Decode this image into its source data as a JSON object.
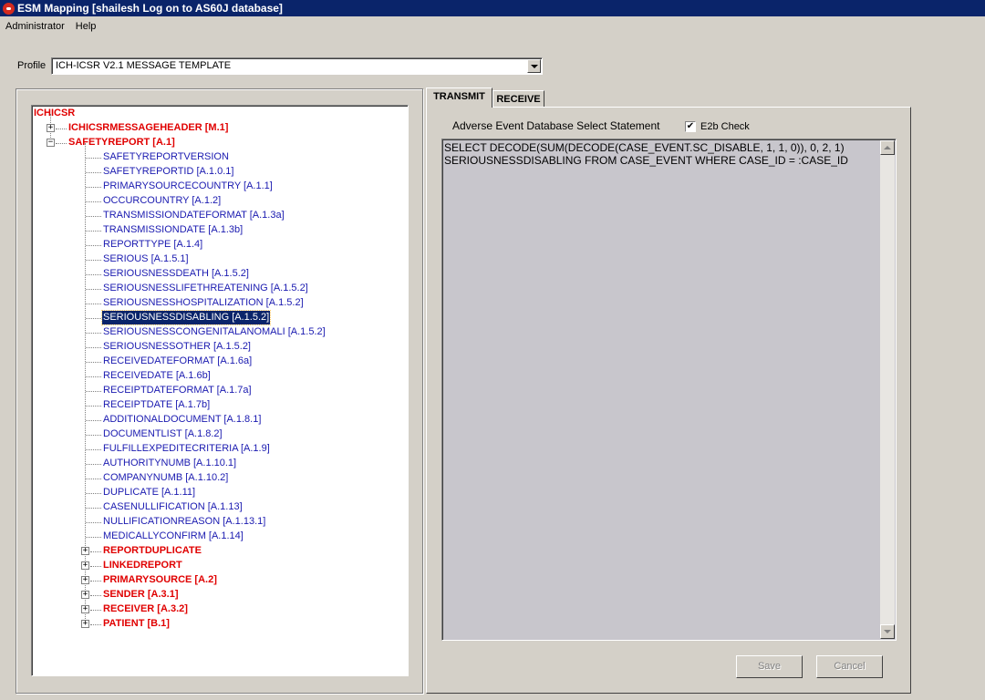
{
  "window": {
    "title": "ESM Mapping [shailesh Log on to AS60J database]"
  },
  "menu": [
    {
      "label": "Administrator"
    },
    {
      "label": "Help"
    }
  ],
  "profile": {
    "label": "Profile",
    "value": "ICH-ICSR V2.1 MESSAGE TEMPLATE"
  },
  "tree": {
    "root": "ICHICSR",
    "header_node": "ICHICSRMESSAGEHEADER [M.1]",
    "safety_node": "SAFETYREPORT [A.1]",
    "children": [
      "SAFETYREPORTVERSION",
      "SAFETYREPORTID [A.1.0.1]",
      "PRIMARYSOURCECOUNTRY [A.1.1]",
      "OCCURCOUNTRY [A.1.2]",
      "TRANSMISSIONDATEFORMAT [A.1.3a]",
      "TRANSMISSIONDATE [A.1.3b]",
      "REPORTTYPE [A.1.4]",
      "SERIOUS [A.1.5.1]",
      "SERIOUSNESSDEATH [A.1.5.2]",
      "SERIOUSNESSLIFETHREATENING [A.1.5.2]",
      "SERIOUSNESSHOSPITALIZATION [A.1.5.2]",
      "SERIOUSNESSDISABLING [A.1.5.2]",
      "SERIOUSNESSCONGENITALANOMALI [A.1.5.2]",
      "SERIOUSNESSOTHER [A.1.5.2]",
      "RECEIVEDATEFORMAT [A.1.6a]",
      "RECEIVEDATE [A.1.6b]",
      "RECEIPTDATEFORMAT [A.1.7a]",
      "RECEIPTDATE [A.1.7b]",
      "ADDITIONALDOCUMENT [A.1.8.1]",
      "DOCUMENTLIST [A.1.8.2]",
      "FULFILLEXPEDITECRITERIA [A.1.9]",
      "AUTHORITYNUMB [A.1.10.1]",
      "COMPANYNUMB [A.1.10.2]",
      "DUPLICATE [A.1.11]",
      "CASENULLIFICATION [A.1.13]",
      "NULLIFICATIONREASON [A.1.13.1]",
      "MEDICALLYCONFIRM [A.1.14]"
    ],
    "selected_index": 11,
    "groups": [
      "REPORTDUPLICATE",
      "LINKEDREPORT",
      "PRIMARYSOURCE [A.2]",
      "SENDER [A.3.1]",
      "RECEIVER [A.3.2]",
      "PATIENT [B.1]"
    ]
  },
  "tabs": [
    {
      "label": "TRANSMIT",
      "active": true
    },
    {
      "label": "RECEIVE",
      "active": false
    }
  ],
  "transmit": {
    "statement_label": "Adverse Event Database Select Statement",
    "e2b_check_label": "E2b Check",
    "e2b_checked": true,
    "check_glyph": "✔",
    "sql": "SELECT DECODE(SUM(DECODE(CASE_EVENT.SC_DISABLE, 1, 1, 0)), 0, 2, 1)\nSERIOUSNESSDISABLING FROM CASE_EVENT WHERE CASE_ID = :CASE_ID"
  },
  "buttons": {
    "save": "Save",
    "cancel": "Cancel"
  },
  "glyphs": {
    "expand": "+",
    "collapse": "−"
  }
}
